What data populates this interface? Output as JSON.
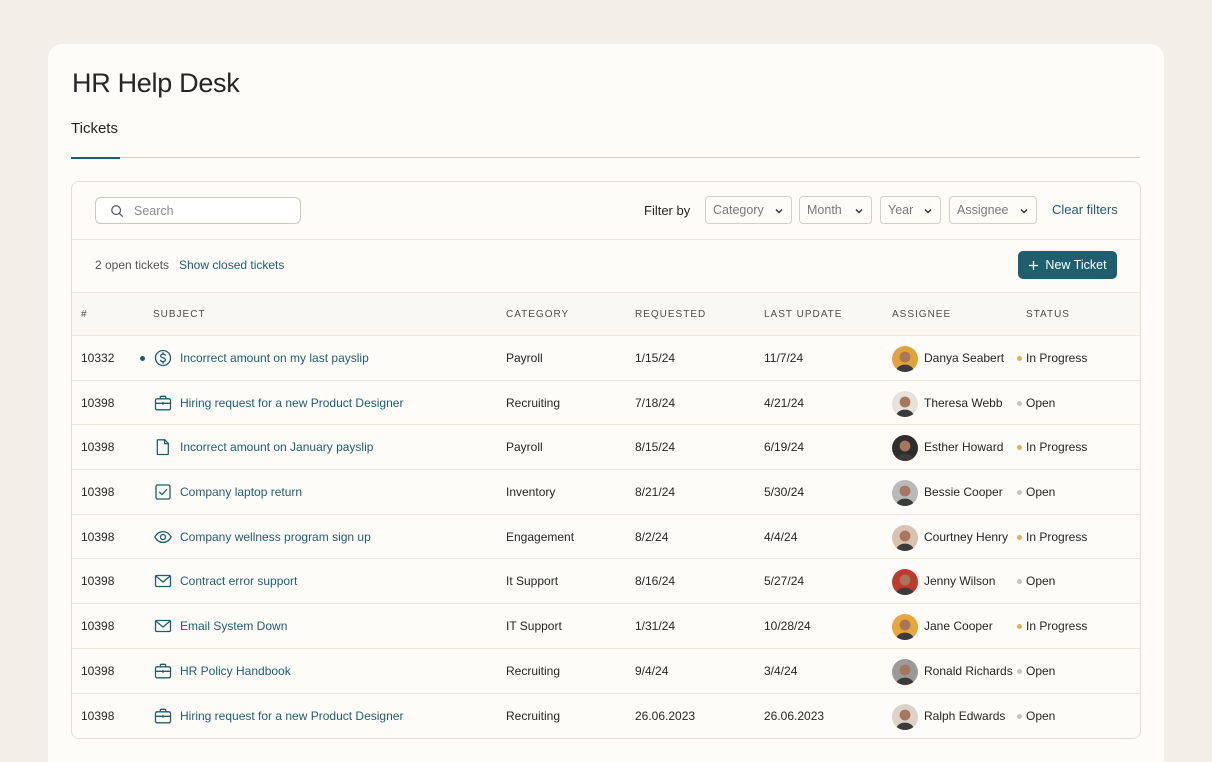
{
  "app": {
    "title": "HR Help Desk"
  },
  "tabs": [
    {
      "label": "Tickets",
      "active": true
    }
  ],
  "search": {
    "placeholder": "Search",
    "value": ""
  },
  "filters": {
    "label": "Filter by",
    "selects": [
      {
        "name": "category",
        "value": "Category"
      },
      {
        "name": "month",
        "value": "Month"
      },
      {
        "name": "year",
        "value": "Year"
      },
      {
        "name": "assignee",
        "value": "Assignee"
      }
    ],
    "clear_label": "Clear filters"
  },
  "summary": {
    "open_count": "2 open tickets",
    "show_closed_label": "Show closed tickets",
    "new_ticket_label": "New Ticket"
  },
  "columns": [
    "#",
    "Subject",
    "Category",
    "Requested",
    "Last Update",
    "Assignee",
    "Status"
  ],
  "colors": {
    "accent": "#1e5f6e",
    "in_progress": "#e3b34b",
    "open": "#c4c4c4"
  },
  "tickets": [
    {
      "id": "10332",
      "unread": true,
      "icon": "dollar-icon",
      "subject": "Incorrect amount on my last payslip",
      "category": "Payroll",
      "requested": "1/15/24",
      "updated": "11/7/24",
      "assignee": "Danya Seabert",
      "avatar": "#e2a33a",
      "status": "In Progress"
    },
    {
      "id": "10398",
      "unread": false,
      "icon": "briefcase-icon",
      "subject": "Hiring request for a new Product Designer",
      "category": "Recruiting",
      "requested": "7/18/24",
      "updated": "4/21/24",
      "assignee": "Theresa Webb",
      "avatar": "#e8e2dc",
      "status": "Open"
    },
    {
      "id": "10398",
      "unread": false,
      "icon": "document-icon",
      "subject": "Incorrect amount on January payslip",
      "category": "Payroll",
      "requested": "8/15/24",
      "updated": "6/19/24",
      "assignee": "Esther Howard",
      "avatar": "#2d2d2d",
      "status": "In Progress"
    },
    {
      "id": "10398",
      "unread": false,
      "icon": "checkbox-icon",
      "subject": "Company laptop return",
      "category": "Inventory",
      "requested": "8/21/24",
      "updated": "5/30/24",
      "assignee": "Bessie Cooper",
      "avatar": "#b9b9b9",
      "status": "Open"
    },
    {
      "id": "10398",
      "unread": false,
      "icon": "eye-icon",
      "subject": "Company wellness program sign up",
      "category": "Engagement",
      "requested": "8/2/24",
      "updated": "4/4/24",
      "assignee": "Courtney Henry",
      "avatar": "#d8c3b0",
      "status": "In Progress"
    },
    {
      "id": "10398",
      "unread": false,
      "icon": "mail-icon",
      "subject": "Contract error support",
      "category": "It Support",
      "requested": "8/16/24",
      "updated": "5/27/24",
      "assignee": "Jenny Wilson",
      "avatar": "#c0392b",
      "status": "Open"
    },
    {
      "id": "10398",
      "unread": false,
      "icon": "mail-icon",
      "subject": "Email System Down",
      "category": "IT Support",
      "requested": "1/31/24",
      "updated": "10/28/24",
      "assignee": "Jane Cooper",
      "avatar": "#e8a63c",
      "status": "In Progress"
    },
    {
      "id": "10398",
      "unread": false,
      "icon": "briefcase-icon",
      "subject": "HR Policy Handbook",
      "category": "Recruiting",
      "requested": "9/4/24",
      "updated": "3/4/24",
      "assignee": "Ronald Richards",
      "avatar": "#9a9a9a",
      "status": "Open"
    },
    {
      "id": "10398",
      "unread": false,
      "icon": "briefcase-icon",
      "subject": "Hiring request for a new Product Designer",
      "category": "Recruiting",
      "requested": "26.06.2023",
      "updated": "26.06.2023",
      "assignee": "Ralph Edwards",
      "avatar": "#dcd3c8",
      "status": "Open"
    }
  ]
}
